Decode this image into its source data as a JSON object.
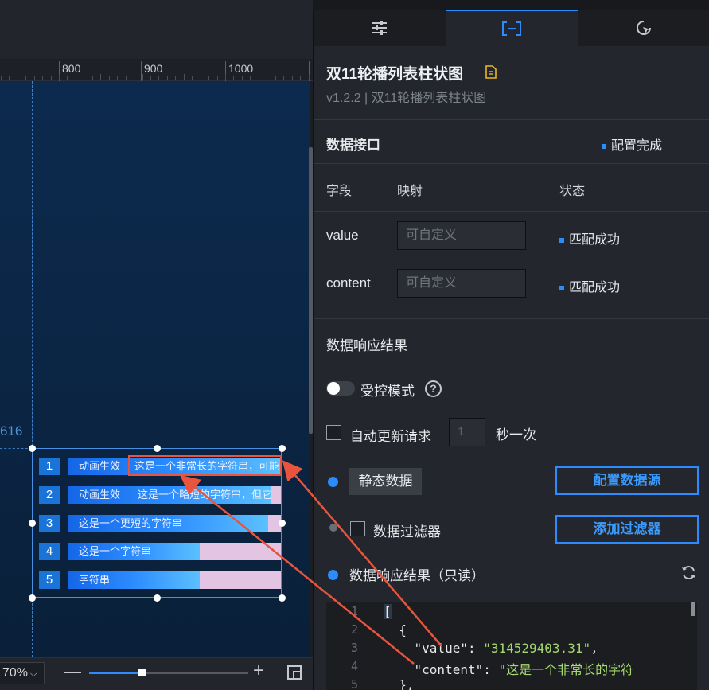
{
  "ruler": {
    "labels": [
      "800",
      "900",
      "1000"
    ]
  },
  "canvas": {
    "coord_label": "616",
    "zoom": "70%",
    "bars": [
      {
        "index": "1",
        "label": "动画生效",
        "text": "这是一个非常长的字符串，可能",
        "fill": 1.0
      },
      {
        "index": "2",
        "label": "动画生效",
        "text": "这是一个略短的字符串，但它",
        "fill": 0.95
      },
      {
        "index": "3",
        "label": "这是一个更短的字符串",
        "text": "",
        "fill": 0.94
      },
      {
        "index": "4",
        "label": "这是一个字符串",
        "text": "",
        "fill": 0.62
      },
      {
        "index": "5",
        "label": "字符串",
        "text": "",
        "fill": 0.62
      }
    ],
    "zoom_slider": 0.33
  },
  "panel": {
    "tabs": [
      {
        "name": "style",
        "icon": "sliders-icon"
      },
      {
        "name": "data",
        "icon": "bracket-icon"
      },
      {
        "name": "interaction",
        "icon": "cursor-icon"
      }
    ],
    "component_title": "双11轮播列表柱状图",
    "component_version": "v1.2.2 | 双11轮播列表柱状图",
    "data_api": {
      "title": "数据接口",
      "status": "配置完成"
    },
    "table_headers": {
      "field": "字段",
      "mapping": "映射",
      "state": "状态"
    },
    "fields": [
      {
        "name": "value",
        "placeholder": "可自定义",
        "status": "匹配成功"
      },
      {
        "name": "content",
        "placeholder": "可自定义",
        "status": "匹配成功"
      }
    ],
    "response_title": "数据响应结果",
    "controlled_mode": "受控模式",
    "help": "?",
    "auto_update": "自动更新请求",
    "interval_value": "1",
    "interval_unit": "秒一次",
    "static_data": "静态数据",
    "configure_source": "配置数据源",
    "data_filter": "数据过滤器",
    "add_filter": "添加过滤器",
    "result_readonly": "数据响应结果（只读）",
    "code": {
      "line_numbers": [
        "1",
        "2",
        "3",
        "4",
        "5"
      ],
      "lines": {
        "l1": "[",
        "l2": "  {",
        "l3_key": "    \"value\"",
        "l3_val": "\"314529403.31\"",
        "l4_key": "    \"content\"",
        "l4_val": "\"这是一个非常长的字符",
        "l5": "  },"
      }
    }
  },
  "colors": {
    "accent": "#2a8cff",
    "annotation": "#e8543c",
    "string": "#a5d86e"
  }
}
